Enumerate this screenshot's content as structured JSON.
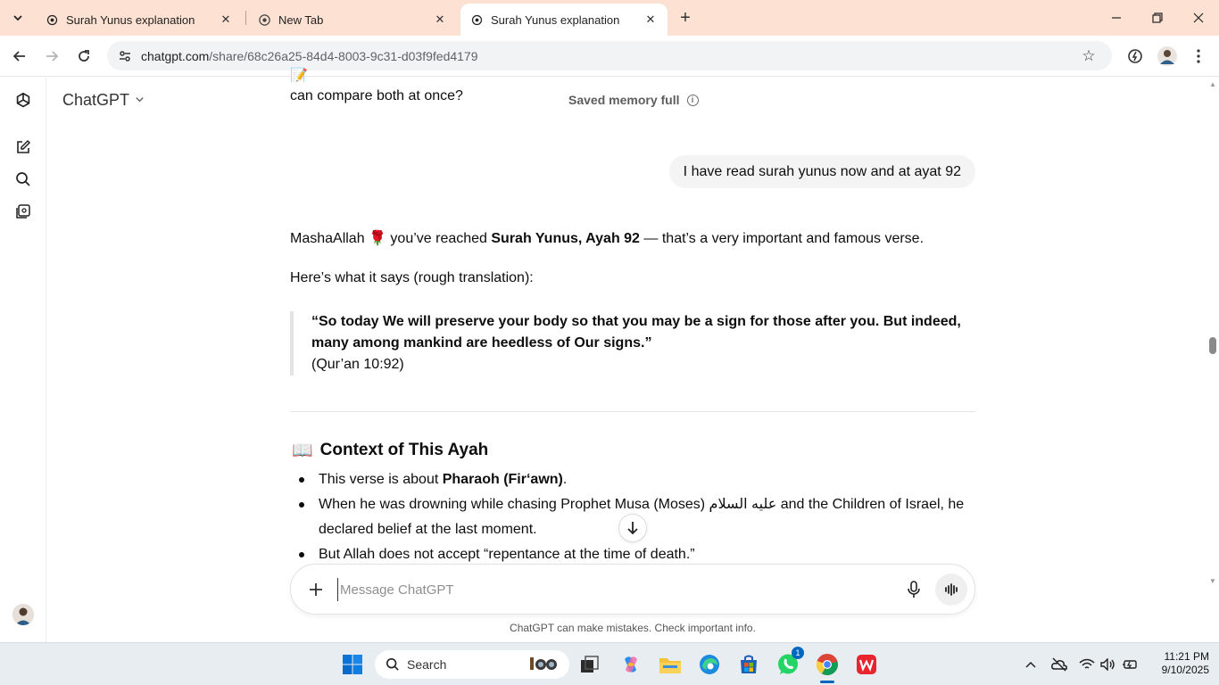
{
  "browser": {
    "tabs": [
      {
        "title": "Surah Yunus explanation",
        "active": false
      },
      {
        "title": "New Tab",
        "active": false
      },
      {
        "title": "Surah Yunus explanation",
        "active": true
      }
    ],
    "url_host": "chatgpt.com",
    "url_path": "/share/68c26a25-84d4-8003-9c31-d03f9fed4179"
  },
  "app": {
    "title": "ChatGPT",
    "memory_status": "Saved memory full"
  },
  "conversation": {
    "prev_assistant_tail": "can compare both at once?",
    "user_message": "I have read surah yunus now and at ayat 92",
    "reply_intro_pre": "MashaAllah 🌹 you’ve reached ",
    "reply_intro_bold": "Surah Yunus, Ayah 92",
    "reply_intro_post": " — that’s a very important and famous verse.",
    "translation_intro": "Here’s what it says (rough translation):",
    "quote_text": "“So today We will preserve your body so that you may be a sign for those after you. But indeed, many among mankind are heedless of Our signs.”",
    "quote_ref": "(Qur’an 10:92)",
    "section_emoji": "📖",
    "section_title": "Context of This Ayah",
    "bullets": [
      {
        "pre": "This verse is about ",
        "bold": "Pharaoh (Fir‘awn)",
        "post": "."
      },
      {
        "pre": "When he was drowning while chasing Prophet Musa (Moses) عليه السلام and the Children of Israel, he declared belief at the last moment.",
        "bold": "",
        "post": ""
      },
      {
        "pre": "But Allah does not accept “repentance at the time of death.”",
        "bold": "",
        "post": ""
      }
    ]
  },
  "composer": {
    "placeholder": "Message ChatGPT",
    "disclaimer": "ChatGPT can make mistakes. Check important info."
  },
  "taskbar": {
    "search_label": "Search",
    "whatsapp_badge": "1",
    "time": "11:21 PM",
    "date": "9/10/2025"
  }
}
